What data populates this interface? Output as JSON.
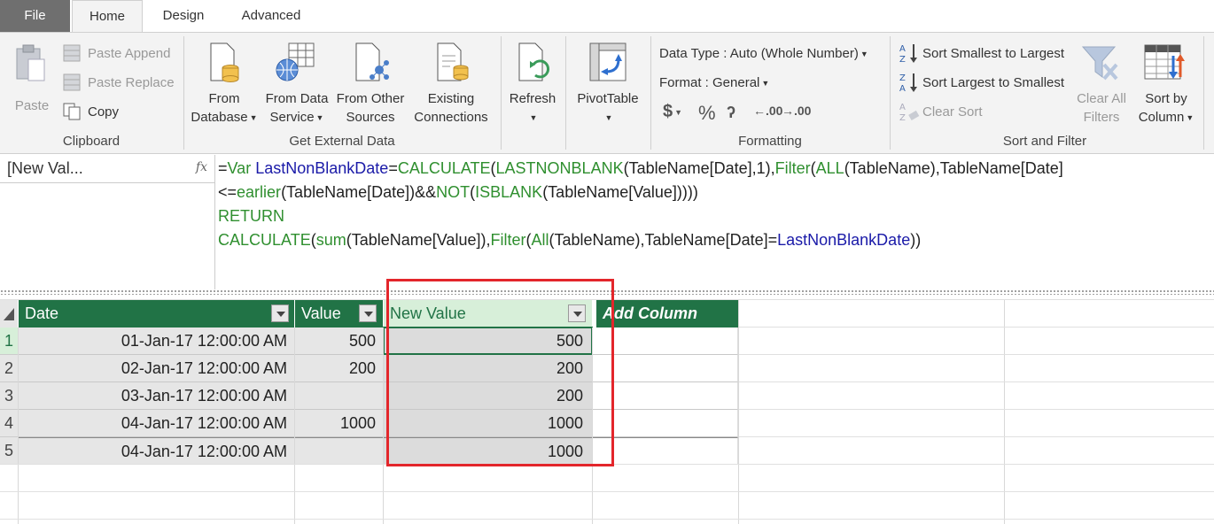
{
  "tabs": {
    "file": "File",
    "home": "Home",
    "design": "Design",
    "advanced": "Advanced"
  },
  "clipboard": {
    "paste": "Paste",
    "paste_append": "Paste Append",
    "paste_replace": "Paste Replace",
    "copy": "Copy",
    "label": "Clipboard"
  },
  "external": {
    "from_database_1": "From",
    "from_database_2": "Database",
    "from_data_service_1": "From Data",
    "from_data_service_2": "Service",
    "from_other_1": "From Other",
    "from_other_2": "Sources",
    "existing_1": "Existing",
    "existing_2": "Connections",
    "label": "Get External Data"
  },
  "refresh": "Refresh",
  "pivottable": "PivotTable",
  "formatting": {
    "data_type": "Data Type : Auto (Whole Number)",
    "format": "Format : General",
    "currency": "$",
    "percent": "%",
    "comma": "ʔ",
    "inc_decimal": ".00",
    "dec_decimal": ".00",
    "label": "Formatting"
  },
  "sortfilter": {
    "sort_asc": "Sort Smallest to Largest",
    "sort_desc": "Sort Largest to Smallest",
    "clear_sort": "Clear Sort",
    "clear_all_1": "Clear All",
    "clear_all_2": "Filters",
    "sort_by_1": "Sort by",
    "sort_by_2": "Column",
    "label": "Sort and Filter"
  },
  "namebox": "[New Val...",
  "fx": "fx",
  "formula": {
    "l1_eq": "=",
    "l1_var": "Var",
    "l1_name": "LastNonBlankDate",
    "l1_eq2": "=",
    "l1_calc": "CALCULATE",
    "l1_p1": "(",
    "l1_lnb": "LASTNONBLANK",
    "l1_args": "(TableName[Date],1),",
    "l1_filter": "Filter",
    "l1_p2": "(",
    "l1_all": "ALL",
    "l1_rest": "(TableName),TableName[Date]",
    "l2_le": "<=",
    "l2_earlier": "earlier",
    "l2_mid": "(TableName[Date])&&",
    "l2_not": "NOT",
    "l2_p": "(",
    "l2_isblank": "ISBLANK",
    "l2_end": "(TableName[Value]))))",
    "l3": "RETURN",
    "l4_calc": "CALCULATE",
    "l4_p": "(",
    "l4_sum": "sum",
    "l4_mid": "(TableName[Value]),",
    "l4_filter": "Filter",
    "l4_p2": "(",
    "l4_all": "All",
    "l4_mid2": "(TableName),TableName[Date]=",
    "l4_var": "LastNonBlankDate",
    "l4_end": "))"
  },
  "columns": {
    "date": "Date",
    "value": "Value",
    "new_value": "New Value",
    "add": "Add Column"
  },
  "rows": [
    {
      "n": "1",
      "date": "01-Jan-17 12:00:00 AM",
      "value": "500",
      "new_value": "500"
    },
    {
      "n": "2",
      "date": "02-Jan-17 12:00:00 AM",
      "value": "200",
      "new_value": "200"
    },
    {
      "n": "3",
      "date": "03-Jan-17 12:00:00 AM",
      "value": "",
      "new_value": "200"
    },
    {
      "n": "4",
      "date": "04-Jan-17 12:00:00 AM",
      "value": "1000",
      "new_value": "1000"
    },
    {
      "n": "5",
      "date": "04-Jan-17 12:00:00 AM",
      "value": "",
      "new_value": "1000"
    }
  ],
  "colors": {
    "accent": "#217346",
    "highlight": "#e3262b"
  }
}
